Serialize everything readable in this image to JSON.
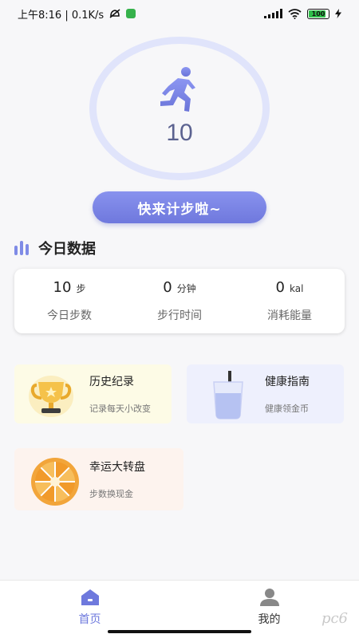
{
  "status_bar": {
    "time_speed": "上午8:16 | 0.1K/s",
    "battery_level": "100"
  },
  "hero": {
    "step_count": "10",
    "start_button": "快来计步啦~"
  },
  "today": {
    "section_title": "今日数据",
    "stats": [
      {
        "value": "10",
        "unit": "步",
        "label": "今日步数"
      },
      {
        "value": "0",
        "unit": "分钟",
        "label": "步行时间"
      },
      {
        "value": "0",
        "unit": "kal",
        "label": "消耗能量"
      }
    ]
  },
  "features": {
    "history": {
      "title": "历史纪录",
      "subtitle": "记录每天小改变",
      "icon": "trophy-icon"
    },
    "health": {
      "title": "健康指南",
      "subtitle": "健康领金币",
      "icon": "water-glass-icon"
    },
    "wheel": {
      "title": "幸运大转盘",
      "subtitle": "步数换现金",
      "icon": "lucky-wheel-icon"
    }
  },
  "nav": {
    "home": "首页",
    "mine": "我的"
  },
  "watermark": "pc6",
  "colors": {
    "accent": "#6e79dd",
    "ring": "#e0e4fb",
    "history_bg": "#fdfbe6",
    "health_bg": "#eef0fd",
    "wheel_bg": "#fdf3ee"
  }
}
